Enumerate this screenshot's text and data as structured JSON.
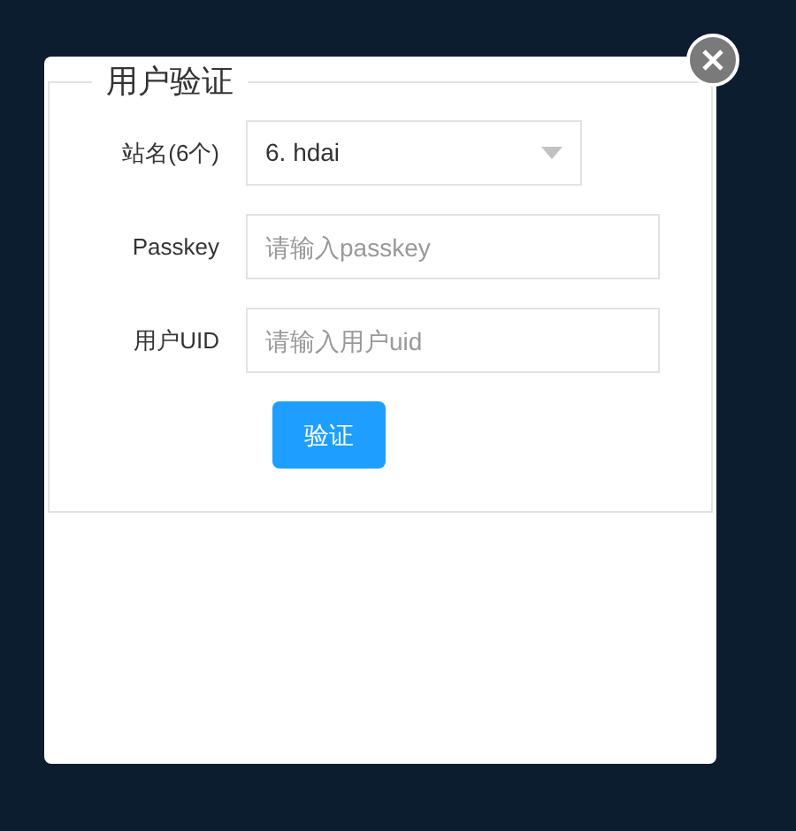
{
  "dialog": {
    "legend": "用户验证",
    "site": {
      "label": "站名(6个)",
      "value": "6. hdai"
    },
    "fields": [
      {
        "label": "Passkey",
        "placeholder": "请输入passkey"
      },
      {
        "label": "用户UID",
        "placeholder": "请输入用户uid"
      }
    ],
    "submit": "验证"
  }
}
